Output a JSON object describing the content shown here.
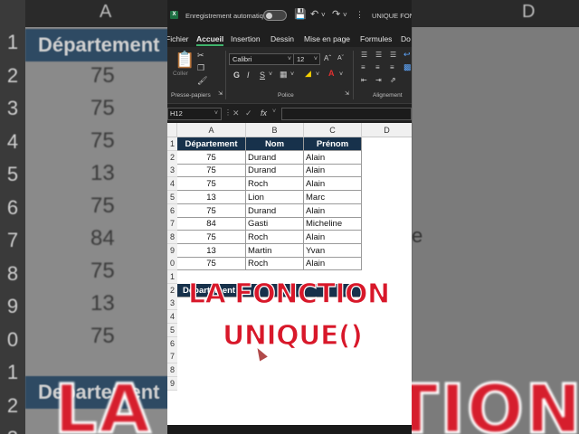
{
  "background": {
    "col_a": "A",
    "col_d": "D",
    "row_numbers": [
      "1",
      "2",
      "3",
      "4",
      "5",
      "6",
      "7",
      "8",
      "9",
      "0",
      "1",
      "2",
      "3"
    ],
    "header": "Département",
    "values": [
      "75",
      "75",
      "75",
      "13",
      "75",
      "84",
      "75",
      "13",
      "75"
    ],
    "side_text": "e",
    "dept_lower": "Departement",
    "big_text": "LA FONCTION"
  },
  "titlebar": {
    "logo": "X",
    "autosave_label": "Enregistrement automatique",
    "doc_title": "UNIQUE FONC"
  },
  "menu": {
    "items": [
      "Fichier",
      "Accueil",
      "Insertion",
      "Dessin",
      "Mise en page",
      "Formules",
      "Do"
    ],
    "active": "Accueil"
  },
  "ribbon": {
    "paste_label": "Coller",
    "clipboard_group": "Presse-papiers",
    "font_name": "Calibri",
    "font_size": "12",
    "bold": "G",
    "italic": "I",
    "underline": "S",
    "font_group": "Police",
    "alignment_group": "Alignement"
  },
  "formula_bar": {
    "name_box": "H12",
    "fx": "fx"
  },
  "columns": [
    "A",
    "B",
    "C",
    "D"
  ],
  "rows": [
    "1",
    "2",
    "3",
    "4",
    "5",
    "6",
    "7",
    "8",
    "9",
    "0",
    "1",
    "2",
    "3",
    "4",
    "5",
    "6",
    "7",
    "8",
    "9"
  ],
  "table": {
    "headers": [
      "Département",
      "Nom",
      "Prénom"
    ],
    "rows": [
      [
        "75",
        "Durand",
        "Alain"
      ],
      [
        "75",
        "Durand",
        "Alain"
      ],
      [
        "75",
        "Roch",
        "Alain"
      ],
      [
        "13",
        "Lion",
        "Marc"
      ],
      [
        "75",
        "Durand",
        "Alain"
      ],
      [
        "84",
        "Gasti",
        "Micheline"
      ],
      [
        "75",
        "Roch",
        "Alain"
      ],
      [
        "13",
        "Martin",
        "Yvan"
      ],
      [
        "75",
        "Roch",
        "Alain"
      ]
    ],
    "second_header": "Département"
  },
  "overlay": {
    "line1": "LA FONCTION",
    "line2": "UNIQUE()"
  }
}
